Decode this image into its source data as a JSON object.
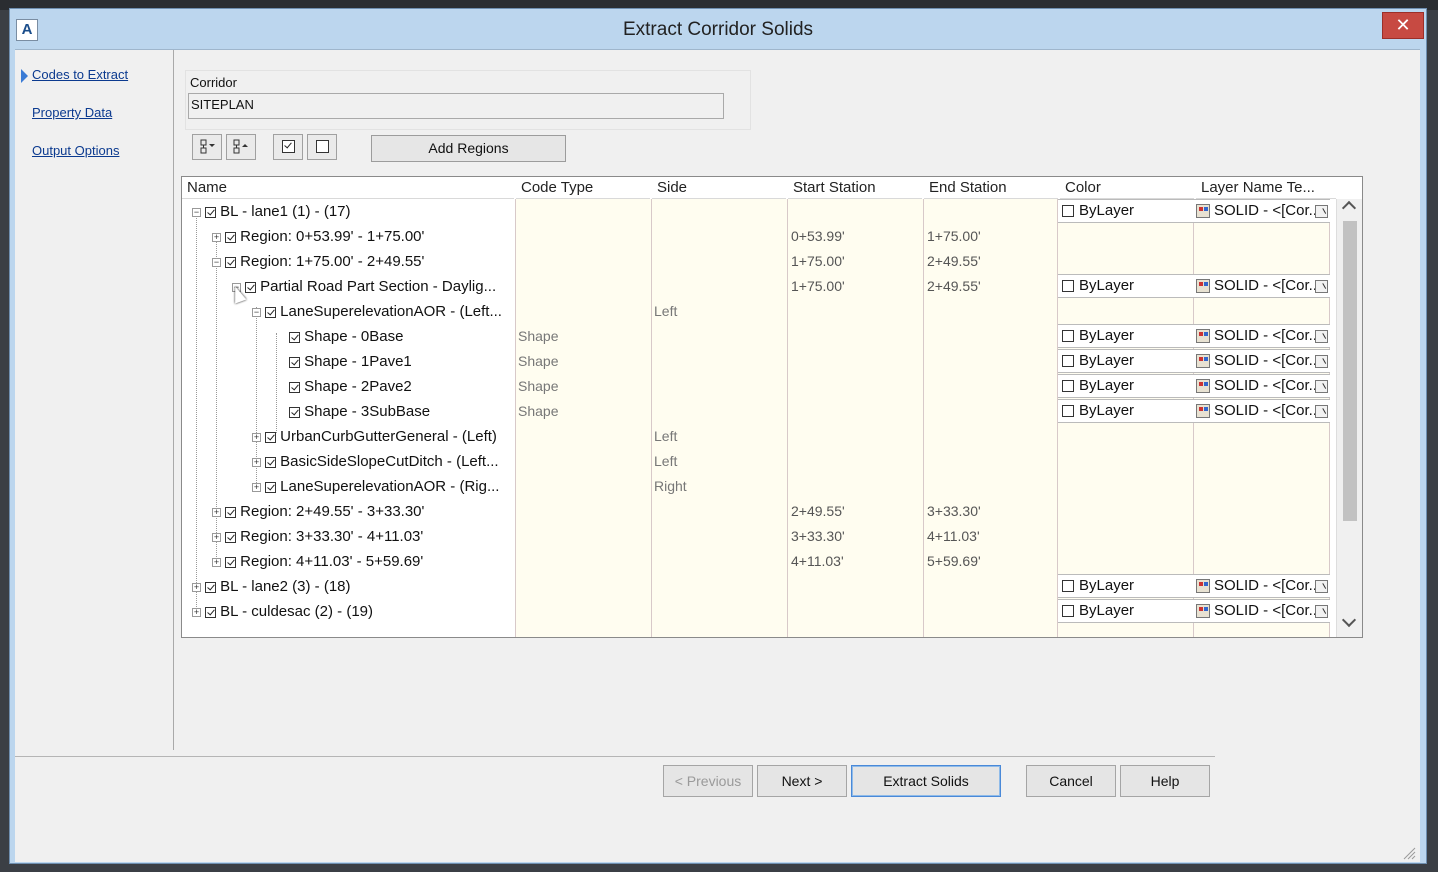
{
  "window": {
    "title": "Extract Corridor Solids",
    "close_label": "✕"
  },
  "nav": {
    "items": [
      "Codes to Extract",
      "Property Data",
      "Output Options"
    ]
  },
  "corridor": {
    "label": "Corridor",
    "value": "SITEPLAN"
  },
  "toolbar": {
    "add_regions": "Add Regions"
  },
  "columns": [
    "Name",
    "Code Type",
    "Side",
    "Start Station",
    "End Station",
    "Color",
    "Layer Name Te..."
  ],
  "rows": [
    {
      "name": "BL - lane1 (1) - (17)",
      "code": "",
      "side": "",
      "start": "",
      "end": "",
      "color": "ByLayer",
      "layer": "SOLID - <[Cor..."
    },
    {
      "name": "Region: 0+53.99' - 1+75.00'",
      "code": "",
      "side": "",
      "start": "0+53.99'",
      "end": "1+75.00'",
      "color": "",
      "layer": ""
    },
    {
      "name": "Region: 1+75.00' - 2+49.55'",
      "code": "",
      "side": "",
      "start": "1+75.00'",
      "end": "2+49.55'",
      "color": "",
      "layer": ""
    },
    {
      "name": "Partial Road Part Section - Daylig...",
      "code": "",
      "side": "",
      "start": "1+75.00'",
      "end": "2+49.55'",
      "color": "ByLayer",
      "layer": "SOLID - <[Cor..."
    },
    {
      "name": "LaneSuperelevationAOR - (Left...",
      "code": "",
      "side": "Left",
      "start": "",
      "end": "",
      "color": "",
      "layer": ""
    },
    {
      "name": "Shape - 0Base",
      "code": "Shape",
      "side": "",
      "start": "",
      "end": "",
      "color": "ByLayer",
      "layer": "SOLID - <[Cor..."
    },
    {
      "name": "Shape - 1Pave1",
      "code": "Shape",
      "side": "",
      "start": "",
      "end": "",
      "color": "ByLayer",
      "layer": "SOLID - <[Cor..."
    },
    {
      "name": "Shape - 2Pave2",
      "code": "Shape",
      "side": "",
      "start": "",
      "end": "",
      "color": "ByLayer",
      "layer": "SOLID - <[Cor..."
    },
    {
      "name": "Shape - 3SubBase",
      "code": "Shape",
      "side": "",
      "start": "",
      "end": "",
      "color": "ByLayer",
      "layer": "SOLID - <[Cor..."
    },
    {
      "name": "UrbanCurbGutterGeneral - (Left)",
      "code": "",
      "side": "Left",
      "start": "",
      "end": "",
      "color": "",
      "layer": ""
    },
    {
      "name": "BasicSideSlopeCutDitch - (Left...",
      "code": "",
      "side": "Left",
      "start": "",
      "end": "",
      "color": "",
      "layer": ""
    },
    {
      "name": "LaneSuperelevationAOR - (Rig...",
      "code": "",
      "side": "Right",
      "start": "",
      "end": "",
      "color": "",
      "layer": ""
    },
    {
      "name": "Region: 2+49.55' - 3+33.30'",
      "code": "",
      "side": "",
      "start": "2+49.55'",
      "end": "3+33.30'",
      "color": "",
      "layer": ""
    },
    {
      "name": "Region: 3+33.30' - 4+11.03'",
      "code": "",
      "side": "",
      "start": "3+33.30'",
      "end": "4+11.03'",
      "color": "",
      "layer": ""
    },
    {
      "name": "Region: 4+11.03' - 5+59.69'",
      "code": "",
      "side": "",
      "start": "4+11.03'",
      "end": "5+59.69'",
      "color": "",
      "layer": ""
    },
    {
      "name": "BL - lane2 (3) - (18)",
      "code": "",
      "side": "",
      "start": "",
      "end": "",
      "color": "ByLayer",
      "layer": "SOLID - <[Cor..."
    },
    {
      "name": "BL - culdesac (2) - (19)",
      "code": "",
      "side": "",
      "start": "",
      "end": "",
      "color": "ByLayer",
      "layer": "SOLID - <[Cor..."
    }
  ],
  "footer": {
    "previous": "< Previous",
    "next": "Next >",
    "extract": "Extract Solids",
    "cancel": "Cancel",
    "help": "Help"
  }
}
